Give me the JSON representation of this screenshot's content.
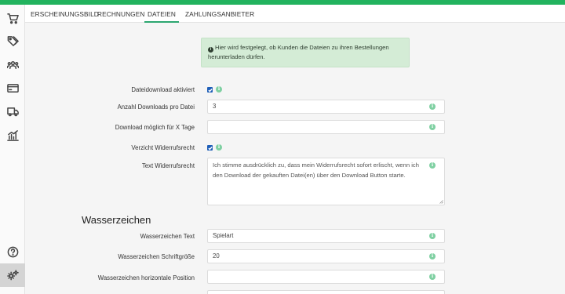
{
  "colors": {
    "accent": "#22b35e",
    "tab_underline": "#2ca670",
    "checkbox": "#1f5fb8",
    "help_icon": "#7fd0a2",
    "alert_bg": "#d4ecd6"
  },
  "sidebar": {
    "items": [
      {
        "icon": "cart-icon"
      },
      {
        "icon": "tags-icon"
      },
      {
        "icon": "users-icon"
      },
      {
        "icon": "credit-card-icon"
      },
      {
        "icon": "truck-icon"
      },
      {
        "icon": "chart-icon"
      },
      {
        "icon": "help-icon"
      },
      {
        "icon": "settings-icon",
        "active": true
      }
    ]
  },
  "tabs": [
    {
      "label": "ERSCHEINUNGSBILD"
    },
    {
      "label": "RECHNUNGEN"
    },
    {
      "label": "DATEIEN",
      "active": true
    },
    {
      "label": "ZAHLUNGSANBIETER"
    }
  ],
  "alert": {
    "text": "Hier wird festgelegt, ob Kunden die Dateien zu ihren Bestellungen herunterladen dürfen."
  },
  "form": {
    "download_enabled": {
      "label": "Dateidownload aktiviert",
      "checked": true
    },
    "downloads_per_file": {
      "label": "Anzahl Downloads pro Datei",
      "value": "3"
    },
    "download_days": {
      "label": "Download möglich für X Tage",
      "value": ""
    },
    "waive_withdrawal": {
      "label": "Verzicht Widerrufsrecht",
      "checked": true
    },
    "withdrawal_text": {
      "label": "Text Widerrufsrecht",
      "value": "Ich stimme ausdrücklich zu, dass mein Widerrufsrecht sofort erlischt, wenn ich den Download der gekauften Datei(en) über den Download Button starte."
    }
  },
  "watermark": {
    "title": "Wasserzeichen",
    "text": {
      "label": "Wasserzeichen Text",
      "value": "Spielart"
    },
    "font_size": {
      "label": "Wasserzeichen Schriftgröße",
      "value": "20"
    },
    "h_position": {
      "label": "Wasserzeichen horizontale Position",
      "value": ""
    }
  }
}
